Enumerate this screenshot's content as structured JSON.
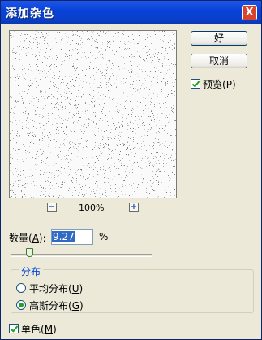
{
  "window": {
    "title": "添加杂色",
    "close_glyph": "X"
  },
  "buttons": {
    "ok": "好",
    "cancel": "取消"
  },
  "preview_toggle": {
    "label": "预览",
    "mnemonic": "P",
    "checked": true
  },
  "zoom": {
    "minus": "−",
    "plus": "+",
    "level": "100%"
  },
  "amount": {
    "label": "数量",
    "mnemonic": "A",
    "value": "9.27",
    "unit": "%",
    "slider_fraction": 0.12
  },
  "distribution": {
    "legend": "分布",
    "options": [
      {
        "label": "平均分布",
        "mnemonic": "U",
        "selected": false
      },
      {
        "label": "高斯分布",
        "mnemonic": "G",
        "selected": true
      }
    ]
  },
  "monochrome": {
    "label": "单色",
    "mnemonic": "M",
    "checked": true
  }
}
